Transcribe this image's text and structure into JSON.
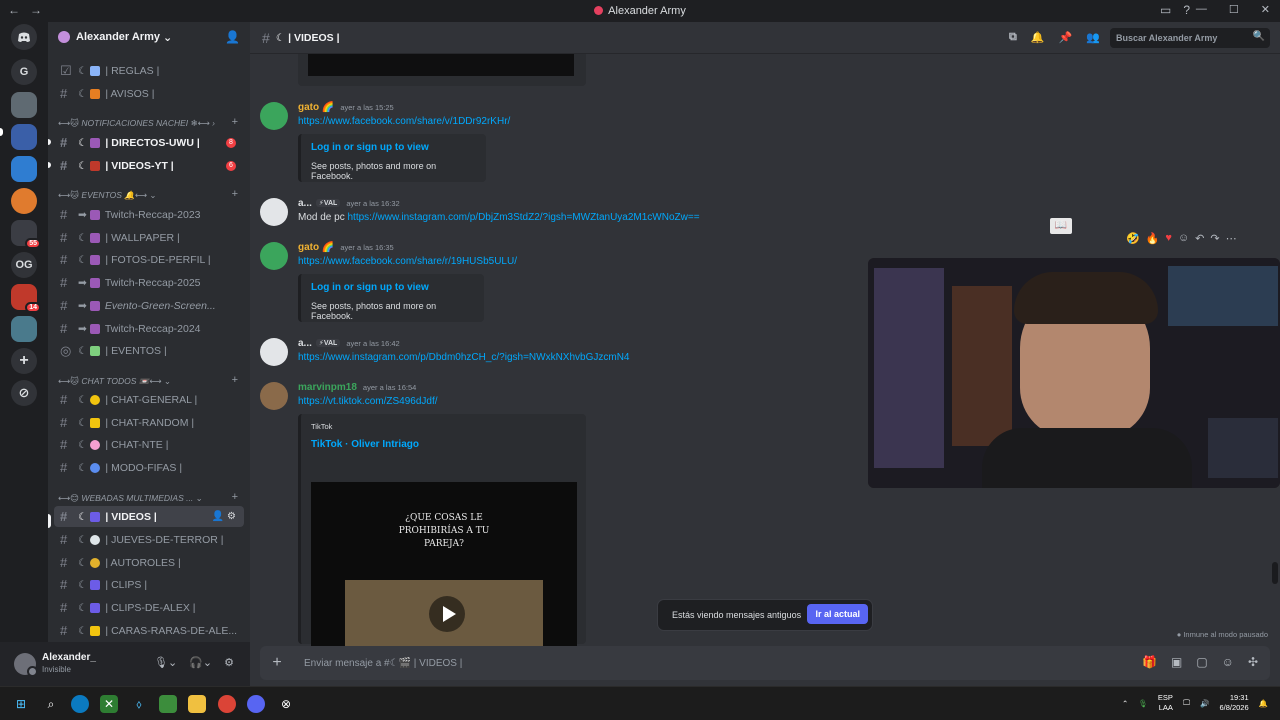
{
  "window": {
    "title": "Alexander Army"
  },
  "server": {
    "name": "Alexander Army"
  },
  "guilds": [
    {
      "label": "G"
    },
    {
      "label": "OG"
    }
  ],
  "guild_badges": {
    "g1": "55",
    "g2": "14"
  },
  "channels": {
    "reglas": "| REGLAS |",
    "avisos": "| AVISOS |",
    "cat_notif": "NOTIFICACIONES NACHEI",
    "directos": "| DIRECTOS-UWU |",
    "directos_badge": "8",
    "videos_yt": "| VIDEOS-YT |",
    "videos_yt_badge": "6",
    "cat_eventos": "EVENTOS",
    "twitch2023": "Twitch-Reccap-2023",
    "wallpaper": "| WALLPAPER |",
    "fotos": "| FOTOS-DE-PERFIL |",
    "twitch2025": "Twitch-Reccap-2025",
    "evento_green": "Evento-Green-Screen...",
    "twitch2024": "Twitch-Reccap-2024",
    "eventos": "| EVENTOS |",
    "cat_chat": "CHAT TODOS",
    "chat_general": "| CHAT-GENERAL |",
    "chat_random": "| CHAT-RANDOM |",
    "chat_nte": "| CHAT-NTE |",
    "modo_fifas": "| MODO-FIFAS |",
    "cat_webadas": "WEBADAS MULTIMEDIAS ...",
    "videos": "| VIDEOS |",
    "jueves": "| JUEVES-DE-TERROR |",
    "autoroles": "| AUTOROLES |",
    "clips": "| CLIPS |",
    "clips_alex": "| CLIPS-DE-ALEX |",
    "caras": "| CARAS-RARAS-DE-ALE..."
  },
  "user": {
    "name": "Alexander_",
    "status": "Invisible"
  },
  "header": {
    "channel": "| VIDEOS |",
    "search_placeholder": "Buscar Alexander Army"
  },
  "messages": [
    {
      "author": "gato",
      "time": "ayer a las 15:25",
      "link": "https://www.facebook.com/share/v/1DDr92rKHr/",
      "embed_title": "Log in or sign up to view",
      "embed_desc": "See posts, photos and more on Facebook."
    },
    {
      "author": "a...",
      "tag": "VAL",
      "time": "ayer a las 16:32",
      "text": "Mod de pc",
      "link": "https://www.instagram.com/p/DbjZm3StdZ2/?igsh=MWZtanUya2M1cWNoZw=="
    },
    {
      "author": "gato",
      "time": "ayer a las 16:35",
      "link": "https://www.facebook.com/share/r/19HUSb5ULU/",
      "embed_title": "Log in or sign up to view",
      "embed_desc": "See posts, photos and more on Facebook."
    },
    {
      "author": "a...",
      "tag": "VAL",
      "time": "ayer a las 16:42",
      "link": "https://www.instagram.com/p/Dbdm0hzCH_c/?igsh=NWxkNXhvbGJzcmN4"
    },
    {
      "author": "marvinpm18",
      "time": "ayer a las 16:54",
      "link": "https://vt.tiktok.com/ZS496dJdf/",
      "embed_provider": "TikTok",
      "embed_title": "TikTok · Oliver Intriago",
      "video_text": "¿QUE COSAS LE PROHIBIRÍAS A TU PAREJA?"
    }
  ],
  "banner": {
    "text": "Estás viendo mensajes antiguos",
    "button": "Ir al actual"
  },
  "immune": "Inmune al modo pausado",
  "composer": {
    "placeholder": "Enviar mensaje a #☾🎬 | VIDEOS |"
  },
  "tray": {
    "lang1": "ESP",
    "lang2": "LAA",
    "time": "19:31",
    "date": "6/8/2026"
  },
  "colors": {
    "accent": "#5865f2",
    "link": "#00a8fc",
    "gato": "#f0b232",
    "marvin": "#3ba55c"
  }
}
